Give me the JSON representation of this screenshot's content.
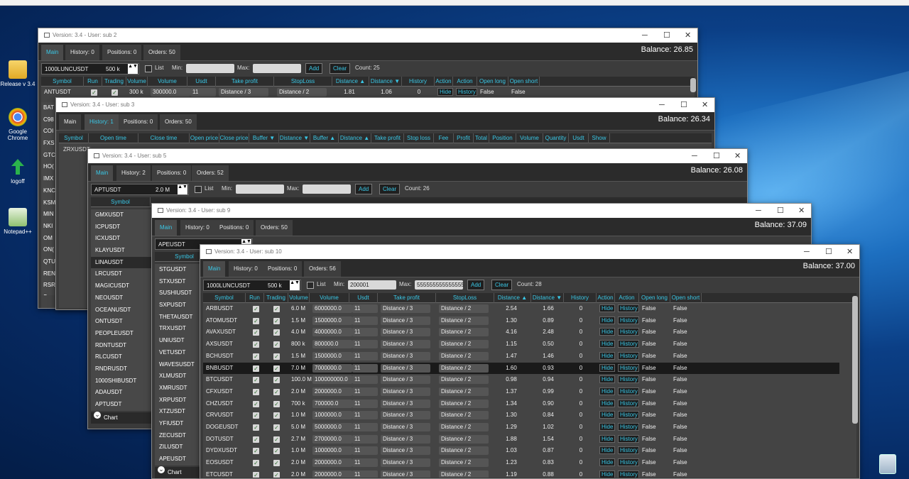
{
  "desktop": {
    "url_fragment": "...",
    "icons": [
      {
        "label": "Release v 3.4",
        "icon": "folder-icon"
      },
      {
        "label": "Google Chrome",
        "icon": "chrome-icon"
      },
      {
        "label": "logoff",
        "icon": "logoff-icon"
      },
      {
        "label": "Notepad++",
        "icon": "notepad-icon"
      }
    ]
  },
  "common": {
    "tabs_main": "Main",
    "add": "Add",
    "clear": "Clear",
    "list": "List",
    "min": "Min:",
    "max": "Max:",
    "chart": "Chart",
    "close": "✕",
    "maximize": "☐",
    "minimize": "─"
  },
  "win1": {
    "title": "Version: 3.4 - User: sub 2",
    "tabs": [
      "Main",
      "History: 0",
      "Positions: 0",
      "Orders: 50"
    ],
    "balance": "Balance: 26.85",
    "combo": "1000LUNCUSDT",
    "vol": "500 k",
    "count": "Count: 25",
    "cols": [
      "Symbol",
      "Run",
      "Trading",
      "Volume",
      "Volume",
      "Usdt",
      "Take profit",
      "StopLoss",
      "Distance ▲",
      "Distance ▼",
      "History",
      "Action",
      "Action",
      "Open long",
      "Open short"
    ],
    "row": {
      "symbol": "ANTUSDT",
      "vol": "300 k",
      "volume": "300000.0",
      "usdt": "11",
      "tp": "Distance / 3",
      "sl": "Distance / 2",
      "d1": "1.81",
      "d2": "1.06",
      "hist": "0",
      "hide": "Hide",
      "history": "History",
      "ol": "False",
      "os": "False"
    },
    "left": [
      "BAT",
      "C98",
      "COI",
      "FXS",
      "GTC",
      "HO(",
      "IMX",
      "KNC",
      "KSM",
      "MIN",
      "NKI",
      "OM",
      "ON(",
      "QTU",
      "REN",
      "RSR",
      "S"
    ]
  },
  "win2": {
    "title": "Version: 3.4 - User: sub 3",
    "tabs": [
      "Main",
      "History: 1",
      "Positions: 0",
      "Orders: 50"
    ],
    "balance": "Balance: 26.34",
    "cols": [
      "Symbol",
      "Open time",
      "Close time",
      "Open price",
      "Close price",
      "Buffer ▼",
      "Distance ▼",
      "Buffer ▲",
      "Distance ▲",
      "Take profit",
      "Stop loss",
      "Fee",
      "Profit",
      "Total",
      "Position",
      "Volume",
      "Quantity",
      "Usdt",
      "Show"
    ],
    "row": "ZRXUSDT"
  },
  "win3": {
    "title": "Version: 3.4 - User: sub 5",
    "tabs": [
      "Main",
      "History: 2",
      "Positions: 0",
      "Orders: 52"
    ],
    "balance": "Balance: 26.08",
    "combo": "APTUSDT",
    "vol": "2.0 M",
    "count": "Count: 26",
    "col": "Symbol",
    "symbols": [
      "GMXUSDT",
      "ICPUSDT",
      "ICXUSDT",
      "KLAYUSDT",
      "LINAUSDT",
      "LRCUSDT",
      "MAGICUSDT",
      "NEOUSDT",
      "OCEANUSDT",
      "ONTUSDT",
      "PEOPLEUSDT",
      "RDNTUSDT",
      "RLCUSDT",
      "RNDRUSDT",
      "1000SHIBUSDT",
      "ADAUSDT",
      "APTUSDT"
    ]
  },
  "win4": {
    "title": "Version: 3.4 - User: sub 9",
    "tabs": [
      "Main",
      "History: 0",
      "Positions: 0",
      "Orders: 50"
    ],
    "balance": "Balance: 37.09",
    "combo": "APEUSDT",
    "col": "Symbol",
    "symbols": [
      "STGUSDT",
      "STXUSDT",
      "SUSHIUSDT",
      "SXPUSDT",
      "THETAUSDT",
      "TRXUSDT",
      "UNIUSDT",
      "VETUSDT",
      "WAVESUSDT",
      "XLMUSDT",
      "XMRUSDT",
      "XRPUSDT",
      "XTZUSDT",
      "YFIUSDT",
      "ZECUSDT",
      "ZILUSDT",
      "APEUSDT"
    ]
  },
  "win5": {
    "title": "Version: 3.4 - User: sub 10",
    "tabs": [
      "Main",
      "History: 0",
      "Positions: 0",
      "Orders: 56"
    ],
    "balance": "Balance: 37.00",
    "combo": "1000LUNCUSDT",
    "vol": "500 k",
    "min": "200001",
    "max": "555555555555555",
    "count": "Count: 28",
    "cols": [
      "Symbol",
      "Run",
      "Trading",
      "Volume",
      "Volume",
      "Usdt",
      "Take profit",
      "StopLoss",
      "Distance ▲",
      "Distance ▼",
      "History",
      "Action",
      "Action",
      "Open long",
      "Open short"
    ],
    "rows": [
      [
        "ARBUSDT",
        "6.0 M",
        "6000000.0",
        "11",
        "2.54",
        "1.66"
      ],
      [
        "ATOMUSDT",
        "1.5 M",
        "1500000.0",
        "11",
        "1.30",
        "0.89"
      ],
      [
        "AVAXUSDT",
        "4.0 M",
        "4000000.0",
        "11",
        "4.16",
        "2.48"
      ],
      [
        "AXSUSDT",
        "800 k",
        "800000.0",
        "11",
        "1.15",
        "0.50"
      ],
      [
        "BCHUSDT",
        "1.5 M",
        "1500000.0",
        "11",
        "1.47",
        "1.46"
      ],
      [
        "BNBUSDT",
        "7.0 M",
        "7000000.0",
        "11",
        "1.60",
        "0.93"
      ],
      [
        "BTCUSDT",
        "100.0 M",
        "100000000.0",
        "11",
        "0.98",
        "0.94"
      ],
      [
        "CFXUSDT",
        "2.0 M",
        "2000000.0",
        "11",
        "1.37",
        "0.99"
      ],
      [
        "CHZUSDT",
        "700 k",
        "700000.0",
        "11",
        "1.34",
        "0.90"
      ],
      [
        "CRVUSDT",
        "1.0 M",
        "1000000.0",
        "11",
        "1.30",
        "0.84"
      ],
      [
        "DOGEUSDT",
        "5.0 M",
        "5000000.0",
        "11",
        "1.29",
        "1.02"
      ],
      [
        "DOTUSDT",
        "2.7 M",
        "2700000.0",
        "11",
        "1.88",
        "1.54"
      ],
      [
        "DYDXUSDT",
        "1.0 M",
        "1000000.0",
        "11",
        "1.03",
        "0.87"
      ],
      [
        "EOSUSDT",
        "2.0 M",
        "2000000.0",
        "11",
        "1.23",
        "0.83"
      ],
      [
        "ETCUSDT",
        "2.0 M",
        "2000000.0",
        "11",
        "1.19",
        "0.88"
      ]
    ],
    "tp": "Distance / 3",
    "sl": "Distance / 2",
    "hist": "0",
    "hide": "Hide",
    "history": "History",
    "ol": "False",
    "os": "False",
    "selected_index": 5
  }
}
